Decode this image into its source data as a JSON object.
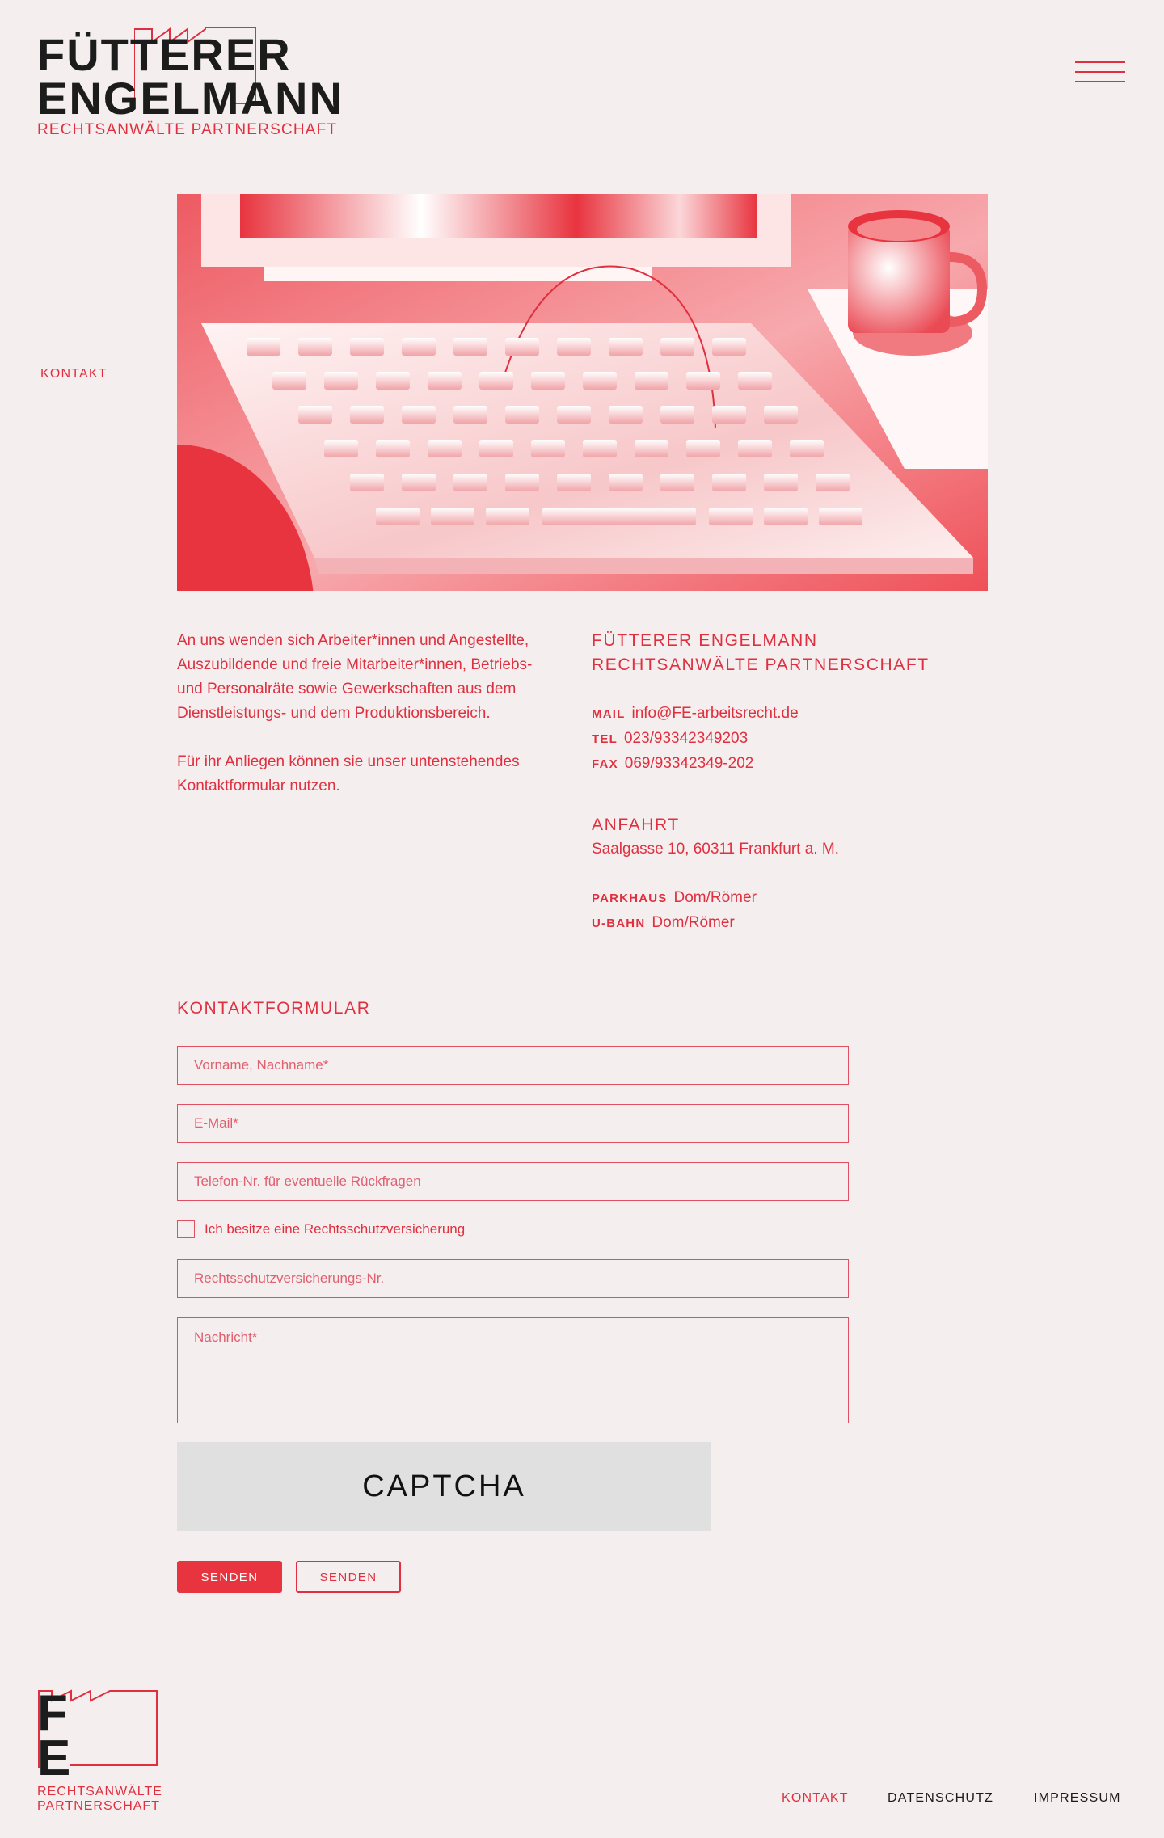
{
  "brand": {
    "line1": "FÜTTERER",
    "line2": "ENGELMANN",
    "subtitle": "RECHTSANWÄLTE PARTNERSCHAFT"
  },
  "side_label": "KONTAKT",
  "intro": {
    "p1": "An uns wenden sich Arbeiter*innen und Angestellte, Auszubildende und freie Mitarbeiter*innen, Betriebs- und Personalräte sowie Gewerkschaften aus dem Dienstleistungs- und dem Produktionsbereich.",
    "p2": "Für ihr Anliegen können sie unser untenstehendes Kontaktformular nutzen."
  },
  "contact": {
    "name_line1": "FÜTTERER ENGELMANN",
    "name_line2": "RECHTSANWÄLTE PARTNERSCHAFT",
    "mail_label": "MAIL",
    "mail_value": "info@FE-arbeitsrecht.de",
    "tel_label": "TEL",
    "tel_value": "023/93342349203",
    "fax_label": "FAX",
    "fax_value": "069/93342349-202",
    "directions_heading": "ANFAHRT",
    "address": "Saalgasse 10, 60311 Frankfurt a. M.",
    "parking_label": "PARKHAUS",
    "parking_value": "Dom/Römer",
    "subway_label": "U-BAHN",
    "subway_value": "Dom/Römer"
  },
  "form": {
    "title": "KONTAKTFORMULAR",
    "name_placeholder": "Vorname, Nachname*",
    "email_placeholder": "E-Mail*",
    "phone_placeholder": "Telefon-Nr. für eventuelle Rückfragen",
    "insurance_checkbox_label": "Ich besitze eine Rechtsschutzversicherung",
    "insurance_number_placeholder": "Rechtsschutzversicherungs-Nr.",
    "message_placeholder": "Nachricht*",
    "captcha_text": "CAPTCHA",
    "submit_label": "SENDEN",
    "submit_label_alt": "SENDEN"
  },
  "footer": {
    "logo_letter_1": "F",
    "logo_letter_2": "E",
    "logo_sub_1": "RECHTSANWÄLTE",
    "logo_sub_2": "PARTNERSCHAFT",
    "nav": [
      "KONTAKT",
      "DATENSCHUTZ",
      "IMPRESSUM"
    ]
  },
  "colors": {
    "background": "#f5eeee",
    "accent": "#e03040",
    "text_dark": "#1c1c1c",
    "captcha_bg": "#e1e0e0"
  },
  "icons": {
    "menu": "hamburger-menu-icon"
  }
}
